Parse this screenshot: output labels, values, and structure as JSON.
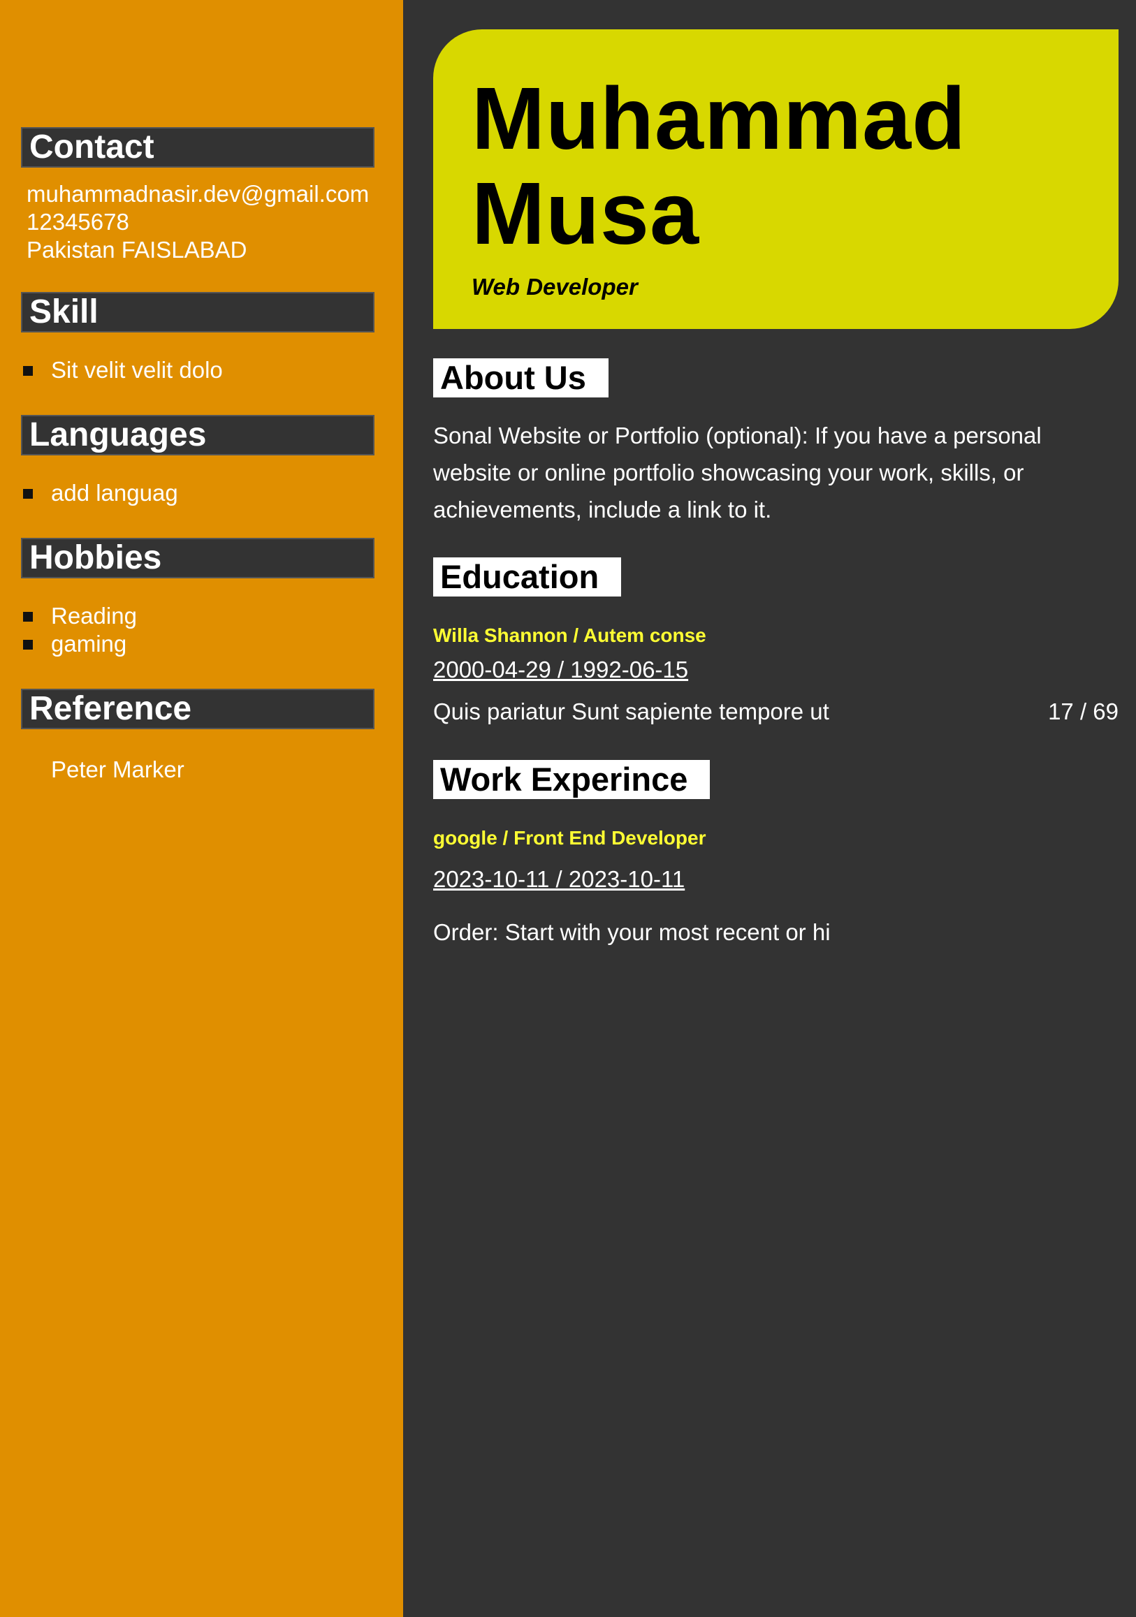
{
  "sidebar": {
    "contact_heading": "Contact",
    "email": "muhammadnasir.dev@gmail.com",
    "phone": "12345678",
    "location": "Pakistan FAISLABAD",
    "skill_heading": "Skill",
    "skills": [
      "Sit velit velit dolo"
    ],
    "languages_heading": "Languages",
    "languages": [
      "add languag"
    ],
    "hobbies_heading": "Hobbies",
    "hobbies": [
      "Reading",
      "gaming"
    ],
    "reference_heading": "Reference",
    "references": [
      "Peter Marker"
    ]
  },
  "header": {
    "first_name": "Muhammad",
    "last_name": "Musa",
    "role": "Web Developer"
  },
  "about": {
    "heading": "About Us",
    "text": "Sonal Website or Portfolio (optional): If you have a personal website or online portfolio showcasing your work, skills, or achievements, include a link to it."
  },
  "education": {
    "heading": "Education",
    "entries": [
      {
        "title": "Willa Shannon / Autem conse",
        "dates": "2000-04-29 / 1992-06-15",
        "description": "Quis pariatur Sunt sapiente tempore ut",
        "score": "17 / 69"
      }
    ]
  },
  "work": {
    "heading": "Work Experince",
    "entries": [
      {
        "title": "google / Front End Developer",
        "dates": "2023-10-11 / 2023-10-11",
        "description": "Order: Start with your most recent or hi"
      }
    ]
  },
  "colors": {
    "sidebar_bg": "#e08f00",
    "main_bg": "#333333",
    "hero_bg": "#d8d800",
    "entry_title": "#ffff33"
  }
}
